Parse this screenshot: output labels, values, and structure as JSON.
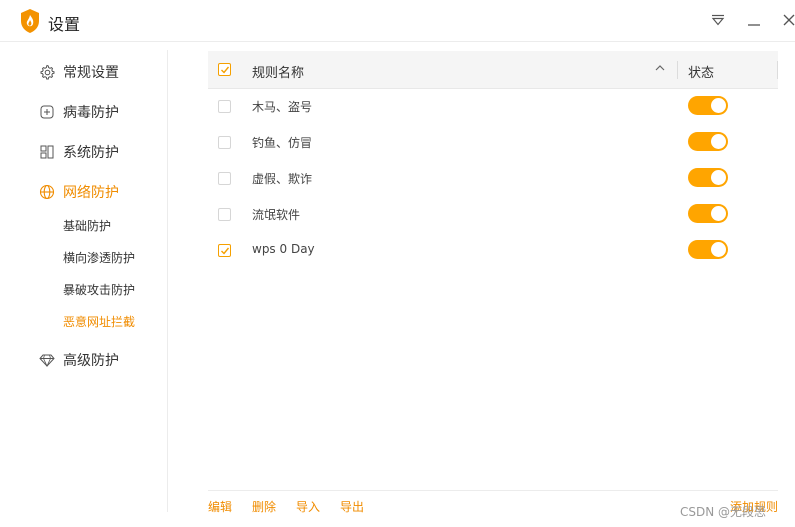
{
  "window": {
    "title": "设置"
  },
  "sidebar": {
    "items": [
      {
        "label": "常规设置",
        "icon": "gear-icon"
      },
      {
        "label": "病毒防护",
        "icon": "plus-square-icon"
      },
      {
        "label": "系统防护",
        "icon": "grid-icon"
      },
      {
        "label": "网络防护",
        "icon": "globe-icon",
        "active": true,
        "children": [
          {
            "label": "基础防护"
          },
          {
            "label": "横向渗透防护"
          },
          {
            "label": "暴破攻击防护"
          },
          {
            "label": "恶意网址拦截",
            "active": true
          }
        ]
      },
      {
        "label": "高级防护",
        "icon": "diamond-icon"
      }
    ]
  },
  "table": {
    "header": {
      "name": "规则名称",
      "status": "状态",
      "select_all_checked": true
    },
    "rows": [
      {
        "name": "木马、盗号",
        "checked": false,
        "enabled": true
      },
      {
        "name": "钓鱼、仿冒",
        "checked": false,
        "enabled": true
      },
      {
        "name": "虚假、欺诈",
        "checked": false,
        "enabled": true
      },
      {
        "name": "流氓软件",
        "checked": false,
        "enabled": true
      },
      {
        "name": "wps 0 Day",
        "checked": true,
        "enabled": true
      }
    ]
  },
  "footer": {
    "edit": "编辑",
    "delete": "删除",
    "import": "导入",
    "export": "导出",
    "add_rule": "添加规则"
  },
  "watermark": "CSDN @无段思",
  "colors": {
    "accent": "#f08c00",
    "toggle_on": "#ffa500"
  }
}
